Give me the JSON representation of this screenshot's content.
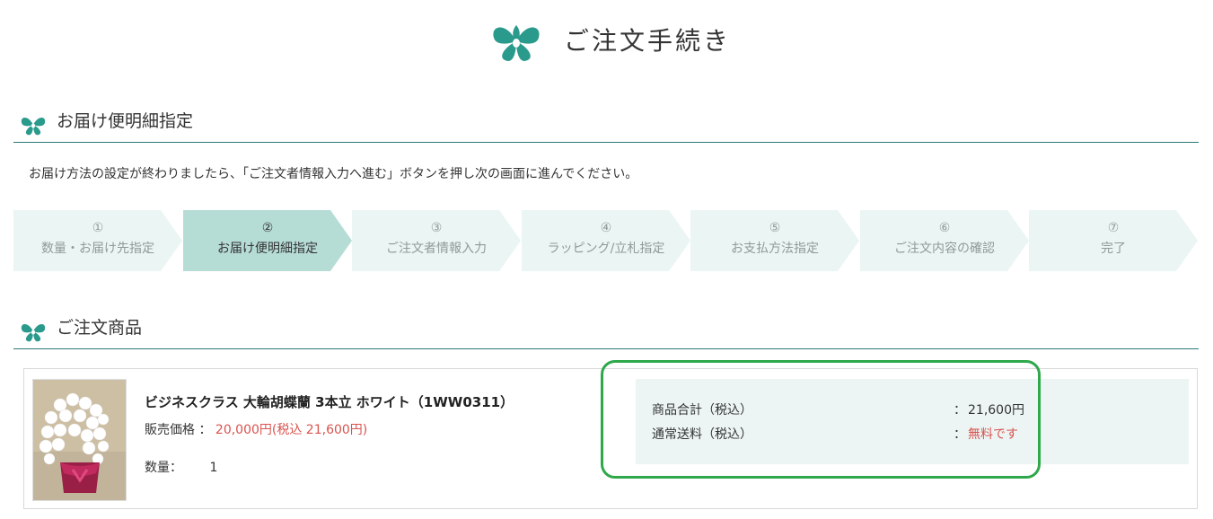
{
  "header": {
    "title": "ご注文手続き",
    "logo_icon": "orchid-logo-icon"
  },
  "delivery_section": {
    "title": "お届け便明細指定",
    "intro": "お届け方法の設定が終わりましたら、「ご注文者情報入力へ進む」ボタンを押し次の画面に進んでください。"
  },
  "steps": [
    {
      "num": "①",
      "label": "数量・お届け先指定",
      "active": false
    },
    {
      "num": "②",
      "label": "お届け便明細指定",
      "active": true
    },
    {
      "num": "③",
      "label": "ご注文者情報入力",
      "active": false
    },
    {
      "num": "④",
      "label": "ラッピング/立札指定",
      "active": false
    },
    {
      "num": "⑤",
      "label": "お支払方法指定",
      "active": false
    },
    {
      "num": "⑥",
      "label": "ご注文内容の確認",
      "active": false
    },
    {
      "num": "⑦",
      "label": "完了",
      "active": false
    }
  ],
  "order_section": {
    "title": "ご注文商品",
    "product": {
      "name": "ビジネスクラス 大輪胡蝶蘭 3本立 ホワイト（1WW0311）",
      "price_label": "販売価格 ：",
      "price_value": "20,000円(税込 21,600円)",
      "qty_label": "数量：",
      "qty_value": "1"
    },
    "totals": {
      "subtotal_label": "商品合計（税込）",
      "subtotal_value": "21,600円",
      "shipping_label": "通常送料（税込）",
      "shipping_value": "無料です",
      "colon": "："
    }
  },
  "colors": {
    "accent": "#2a9a8c",
    "price_red": "#d9534f",
    "highlight_green": "#2ea84a"
  }
}
